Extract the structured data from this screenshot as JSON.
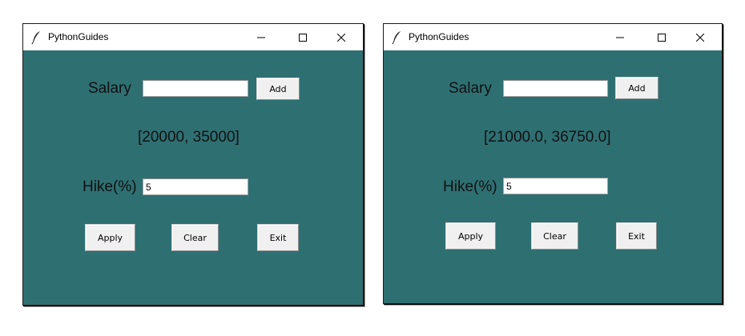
{
  "windows": [
    {
      "title": "PythonGuides",
      "salary_label": "Salary",
      "salary_value": "",
      "add_label": "Add",
      "output_text": "[20000, 35000]",
      "hike_label": "Hike(%)",
      "hike_value": "5",
      "apply_label": "Apply",
      "clear_label": "Clear",
      "exit_label": "Exit"
    },
    {
      "title": "PythonGuides",
      "salary_label": "Salary",
      "salary_value": "",
      "add_label": "Add",
      "output_text": "[21000.0, 36750.0]",
      "hike_label": "Hike(%)",
      "hike_value": "5",
      "apply_label": "Apply",
      "clear_label": "Clear",
      "exit_label": "Exit"
    }
  ],
  "colors": {
    "window_background": "#2e6f72",
    "titlebar_background": "#ffffff",
    "button_face": "#f0f0f0"
  },
  "icons": [
    "feather-icon",
    "minimize-icon",
    "maximize-icon",
    "close-icon"
  ]
}
